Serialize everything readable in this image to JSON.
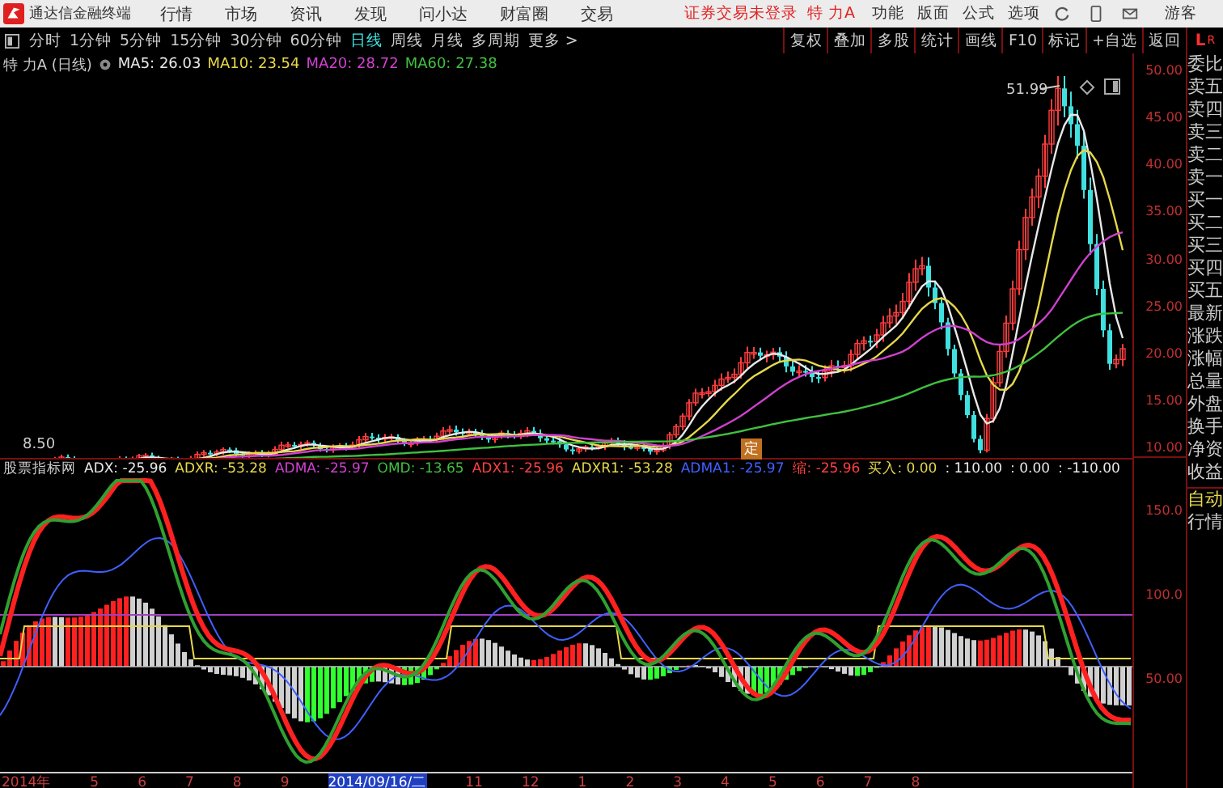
{
  "menu_bar": {
    "app_name": "通达信金融终端",
    "menus": [
      "行情",
      "市场",
      "资讯",
      "发现",
      "问小达",
      "财富圈",
      "交易"
    ],
    "notice": "证券交易未登录",
    "stock": "特 力A",
    "right_menus": [
      "功能",
      "版面",
      "公式",
      "选项"
    ],
    "user": "游客"
  },
  "period_tabs": [
    {
      "label": "分时",
      "selected": false
    },
    {
      "label": "1分钟",
      "selected": false
    },
    {
      "label": "5分钟",
      "selected": false
    },
    {
      "label": "15分钟",
      "selected": false
    },
    {
      "label": "30分钟",
      "selected": false
    },
    {
      "label": "60分钟",
      "selected": false
    },
    {
      "label": "日线",
      "selected": true
    },
    {
      "label": "周线",
      "selected": false
    },
    {
      "label": "月线",
      "selected": false
    },
    {
      "label": "多周期",
      "selected": false
    },
    {
      "label": "更多 >",
      "selected": false
    }
  ],
  "toolbar": [
    "复权",
    "叠加",
    "多股",
    "统计",
    "画线",
    "F10",
    "标记",
    "+自选",
    "返回"
  ],
  "chart_header": {
    "title": "特 力A (日线)",
    "ma": [
      {
        "label": "MA5: 26.03",
        "color": "#e8e8e8"
      },
      {
        "label": "MA10: 23.54",
        "color": "#e6d84a"
      },
      {
        "label": "MA20: 28.72",
        "color": "#d040d0"
      },
      {
        "label": "MA60: 27.38",
        "color": "#40c040"
      }
    ]
  },
  "price_axis": [
    "50.00",
    "45.00",
    "40.00",
    "35.00",
    "30.00",
    "25.00",
    "20.00",
    "15.00",
    "10.00"
  ],
  "annotations": {
    "high": "51.99",
    "low": "8.50",
    "marker": "定"
  },
  "indicator": {
    "name": "股票指标网",
    "values": [
      {
        "text": "ADX: -25.96",
        "color": "#e8e8e8"
      },
      {
        "text": "ADXR: -53.28",
        "color": "#e6d84a"
      },
      {
        "text": "ADMA: -25.97",
        "color": "#d040d0"
      },
      {
        "text": "OMD: -13.65",
        "color": "#40c040"
      },
      {
        "text": "ADX1: -25.96",
        "color": "#ff4040"
      },
      {
        "text": "ADXR1: -53.28",
        "color": "#e6d84a"
      },
      {
        "text": "ADMA1: -25.97",
        "color": "#4060ff"
      },
      {
        "text": "缩: -25.96",
        "color": "#ff4040"
      },
      {
        "text": "买入: 0.00",
        "color": "#e6d84a"
      },
      {
        "text": ": 110.00",
        "color": "#e8e8e8"
      },
      {
        "text": ": 0.00",
        "color": "#e8e8e8"
      },
      {
        "text": ": -110.00",
        "color": "#e8e8e8"
      }
    ]
  },
  "indicator_axis": [
    "150.0",
    "100.0",
    "50.00"
  ],
  "date_axis": [
    {
      "label": "2014年",
      "selected": false
    },
    {
      "label": "5",
      "selected": false
    },
    {
      "label": "6",
      "selected": false
    },
    {
      "label": "7",
      "selected": false
    },
    {
      "label": "8",
      "selected": false
    },
    {
      "label": "9",
      "selected": false
    },
    {
      "label": "2014/09/16/二",
      "selected": true
    },
    {
      "label": "11",
      "selected": false
    },
    {
      "label": "12",
      "selected": false
    },
    {
      "label": "1",
      "selected": false
    },
    {
      "label": "2",
      "selected": false
    },
    {
      "label": "3",
      "selected": false
    },
    {
      "label": "4",
      "selected": false
    },
    {
      "label": "5",
      "selected": false
    },
    {
      "label": "6",
      "selected": false
    },
    {
      "label": "7",
      "selected": false
    },
    {
      "label": "8",
      "selected": false
    }
  ],
  "quote_panel": {
    "badge_left": "L",
    "badge_right": "R",
    "labels": [
      "委比",
      "卖五",
      "卖四",
      "卖三",
      "卖二",
      "卖一",
      "买一",
      "买二",
      "买三",
      "买四",
      "买五",
      "最新",
      "涨跌",
      "涨幅",
      "总量",
      "外盘",
      "换手",
      "净资",
      "收益"
    ],
    "mode_tabs": [
      {
        "label": "自动",
        "selected": true
      },
      {
        "label": "行情",
        "selected": false
      }
    ]
  }
}
